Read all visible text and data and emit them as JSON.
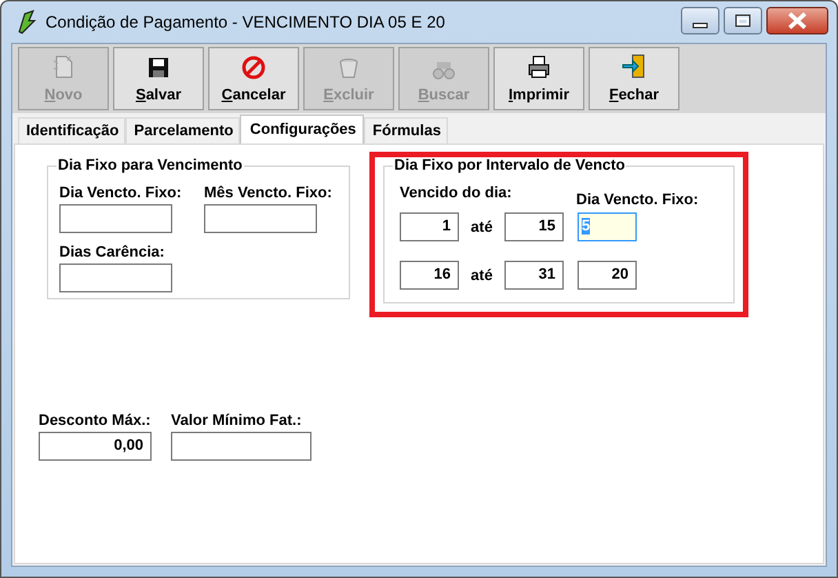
{
  "window": {
    "title": "Condição de Pagamento - VENCIMENTO DIA 05 E 20"
  },
  "toolbar": [
    {
      "label": "Novo",
      "disabled": true
    },
    {
      "label": "Salvar",
      "disabled": false
    },
    {
      "label": "Cancelar",
      "disabled": false
    },
    {
      "label": "Excluir",
      "disabled": true
    },
    {
      "label": "Buscar",
      "disabled": true
    },
    {
      "label": "Imprimir",
      "disabled": false
    },
    {
      "label": "Fechar",
      "disabled": false
    }
  ],
  "tabs": [
    {
      "label": "Identificação",
      "selected": false
    },
    {
      "label": "Parcelamento",
      "selected": false
    },
    {
      "label": "Configurações",
      "selected": true
    },
    {
      "label": "Fórmulas",
      "selected": false
    }
  ],
  "fixed_day_group": {
    "title": "Dia Fixo para Vencimento",
    "fields": [
      {
        "label": "Dia Vencto. Fixo:"
      },
      {
        "label": "Mês Vencto. Fixo:"
      },
      {
        "label": "Dias Carência:"
      }
    ]
  },
  "interval_group": {
    "title": "Dia Fixo por Intervalo de Vencto",
    "highlighted": true,
    "from_label": "Vencido do dia:",
    "fixed_label": "Dia Vencto. Fixo:",
    "rows": [
      {
        "from": "1",
        "separator": "até",
        "to": "15",
        "fixed_day": "5",
        "focused": true
      },
      {
        "from": "16",
        "separator": "até",
        "to": "31",
        "fixed_day": "20",
        "focused": false
      }
    ]
  },
  "bottom_fields": [
    {
      "label": "Desconto Máx.:",
      "value": "0,00"
    },
    {
      "label": "Valor Mínimo Fat.:"
    }
  ]
}
